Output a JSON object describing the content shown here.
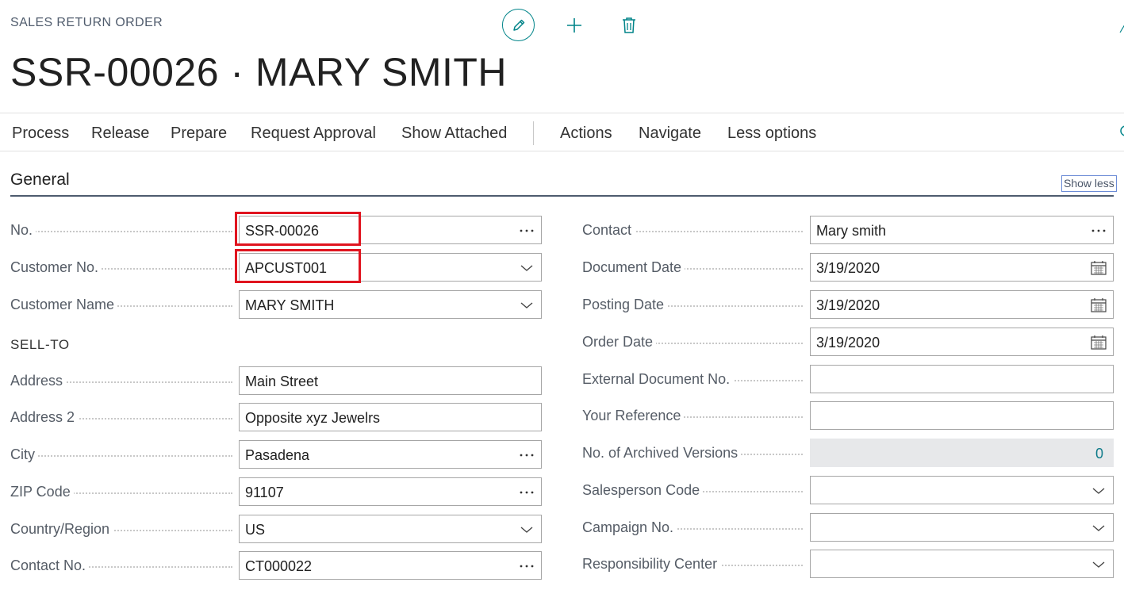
{
  "header": {
    "caption": "SALES RETURN ORDER",
    "title": "SSR-00026 · MARY SMITH"
  },
  "toolbar": {
    "edit_icon": "pencil-icon",
    "new_icon": "plus-icon",
    "delete_icon": "trash-icon",
    "accent": "#008489"
  },
  "action_bar": {
    "items": [
      "Process",
      "Release",
      "Prepare",
      "Request Approval",
      "Show Attached",
      "Actions",
      "Navigate",
      "Less options"
    ]
  },
  "section": {
    "title": "General",
    "toggle": "Show less"
  },
  "left_fields": [
    {
      "label": "No.",
      "value": "SSR-00026",
      "control": "lookup"
    },
    {
      "label": "Customer No.",
      "value": "APCUST001",
      "control": "dropdown"
    },
    {
      "label": "Customer Name",
      "value": "MARY SMITH",
      "control": "dropdown"
    }
  ],
  "sell_to": {
    "heading": "SELL-TO",
    "fields": [
      {
        "label": "Address",
        "value": "Main Street",
        "control": "text"
      },
      {
        "label": "Address 2",
        "value": "Opposite xyz Jewelrs",
        "control": "text"
      },
      {
        "label": "City",
        "value": "Pasadena",
        "control": "lookup"
      },
      {
        "label": "ZIP Code",
        "value": "91107",
        "control": "lookup"
      },
      {
        "label": "Country/Region",
        "value": "US",
        "control": "dropdown"
      },
      {
        "label": "Contact No.",
        "value": "CT000022",
        "control": "lookup"
      }
    ]
  },
  "right_fields": [
    {
      "label": "Contact",
      "value": "Mary smith",
      "control": "lookup"
    },
    {
      "label": "Document Date",
      "value": "3/19/2020",
      "control": "date"
    },
    {
      "label": "Posting Date",
      "value": "3/19/2020",
      "control": "date"
    },
    {
      "label": "Order Date",
      "value": "3/19/2020",
      "control": "date"
    },
    {
      "label": "External Document No.",
      "value": "",
      "control": "text"
    },
    {
      "label": "Your Reference",
      "value": "",
      "control": "text"
    },
    {
      "label": "No. of Archived Versions",
      "value": "0",
      "control": "readonly"
    },
    {
      "label": "Salesperson Code",
      "value": "",
      "control": "dropdown"
    },
    {
      "label": "Campaign No.",
      "value": "",
      "control": "dropdown"
    },
    {
      "label": "Responsibility Center",
      "value": "",
      "control": "dropdown"
    }
  ],
  "highlight_color": "#e0141f"
}
